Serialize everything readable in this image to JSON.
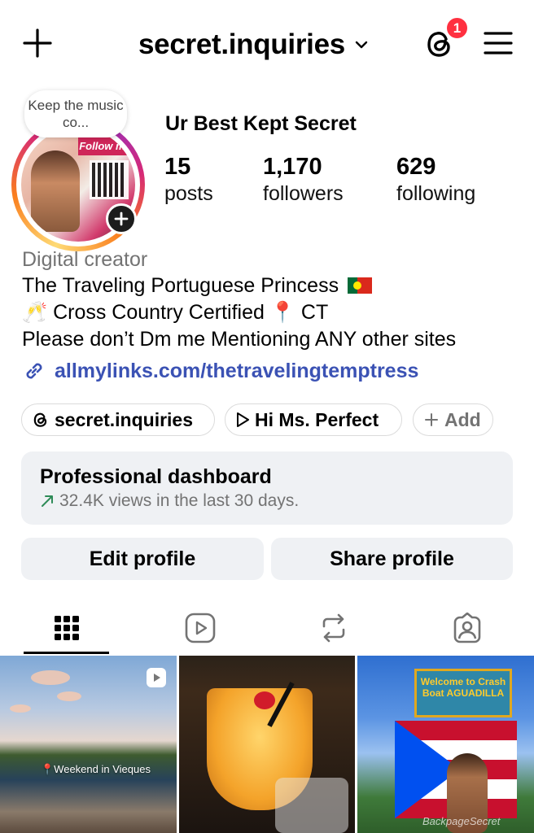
{
  "header": {
    "username": "secret.inquiries",
    "notification_count": "1"
  },
  "profile": {
    "note": "Keep the music co...",
    "display_name": "Ur Best Kept Secret",
    "stats": [
      {
        "value": "15",
        "label": "posts"
      },
      {
        "value": "1,170",
        "label": "followers"
      },
      {
        "value": "629",
        "label": "following"
      }
    ],
    "avatar_banner": "Follow me"
  },
  "bio": {
    "category": "Digital creator",
    "line1": "The Traveling Portuguese Princess",
    "line2_a": "🥂 Cross Country Certified",
    "line2_b": "📍 CT",
    "line3": "Please don’t Dm me Mentioning ANY other sites",
    "link": "allmylinks.com/thetravelingtemptress"
  },
  "chips": [
    {
      "label": "secret.inquiries",
      "icon": "threads-icon"
    },
    {
      "label": "Hi Ms. Perfect",
      "icon": "play-icon"
    },
    {
      "label": "Add",
      "icon": "plus-icon"
    }
  ],
  "dashboard": {
    "title": "Professional dashboard",
    "subtitle": "32.4K views in the last 30 days."
  },
  "actions": {
    "edit": "Edit profile",
    "share": "Share profile"
  },
  "tabs": [
    "grid-icon",
    "reels-icon",
    "reposts-icon",
    "tagged-icon"
  ],
  "grid": [
    {
      "caption": "📍Weekend in Vieques"
    },
    {
      "caption": ""
    },
    {
      "caption": "BackpageSecret",
      "sign": "Welcome to Crash Boat AGUADILLA"
    }
  ],
  "colors": {
    "link": "#3b52b4",
    "badge": "#ff3040",
    "button_bg": "#eff1f4",
    "muted": "#737373"
  }
}
